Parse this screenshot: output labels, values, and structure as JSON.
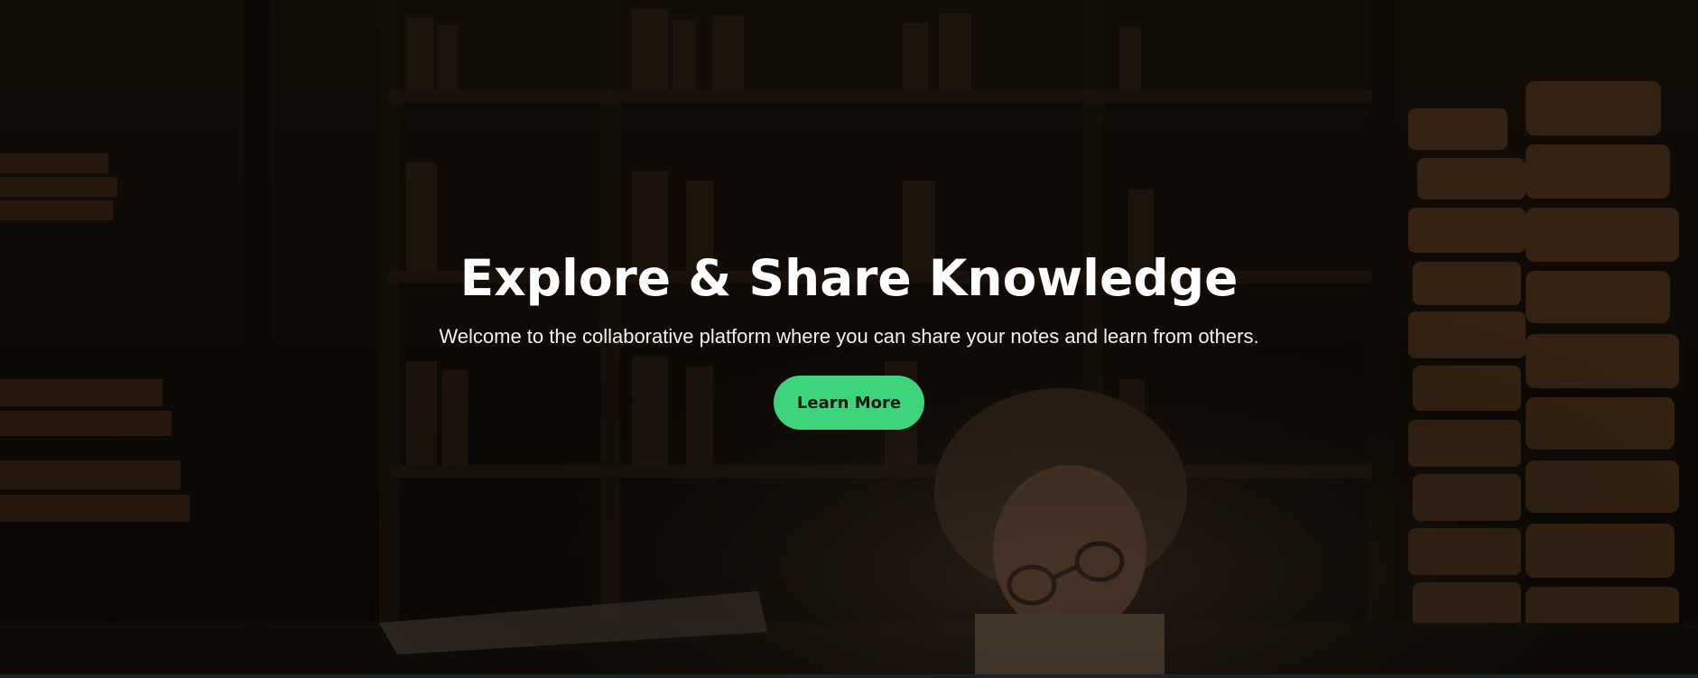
{
  "hero": {
    "title": "Explore & Share Knowledge",
    "subtitle": "Welcome to the collaborative platform where you can share your notes and learn from others.",
    "cta_label": "Learn More"
  },
  "colors": {
    "accent": "#3ed47b",
    "title_text": "#ffffff",
    "background": "#0c0906"
  },
  "background_image": "library-bookshelves-girl-reading"
}
